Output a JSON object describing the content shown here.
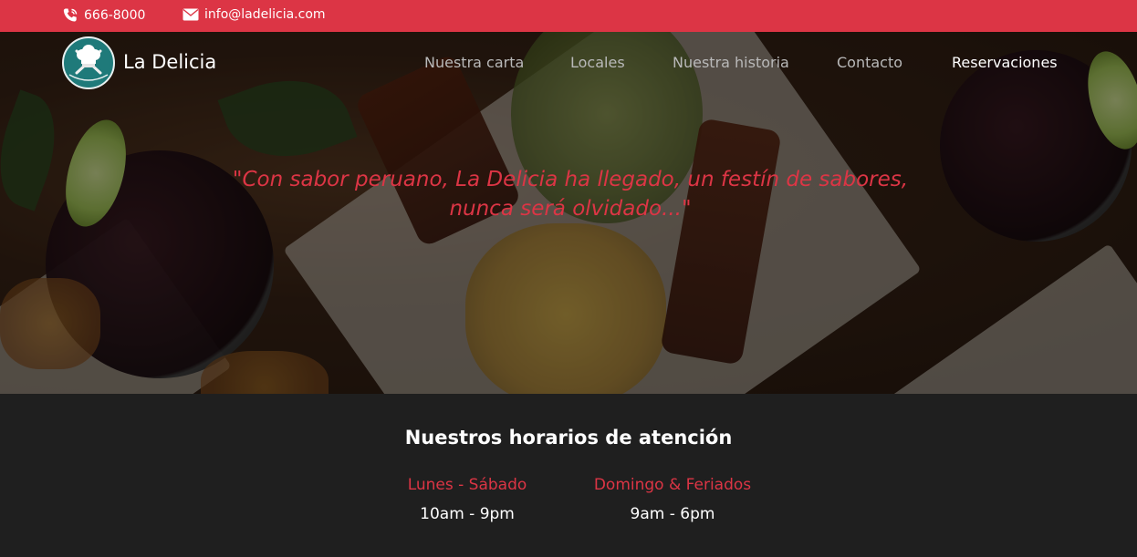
{
  "topbar": {
    "phone": "666-8000",
    "email": "info@ladelicia.com",
    "phone_icon": "phone-icon",
    "email_icon": "envelope-icon"
  },
  "brand": {
    "name": "La Delicia",
    "logo_icon": "chef-hat-logo"
  },
  "nav": {
    "items": [
      {
        "label": "Nuestra carta"
      },
      {
        "label": "Locales"
      },
      {
        "label": "Nuestra historia"
      },
      {
        "label": "Contacto"
      },
      {
        "label": "Reservaciones"
      }
    ],
    "active": "Reservaciones"
  },
  "hero": {
    "quote": "\"Con sabor peruano, La Delicia ha llegado, un festín de sabores, nunca será olvidado...\""
  },
  "hours": {
    "title": "Nuestros horarios de atención",
    "schedule": [
      {
        "days": "Lunes - Sábado",
        "time": "10am - 9pm"
      },
      {
        "days": "Domingo & Feriados",
        "time": "9am - 6pm"
      }
    ]
  },
  "colors": {
    "accent": "#dc3545",
    "dark": "#1f1f1f",
    "nav_text": "#b9b9b9",
    "logo_bg": "#1f7a7a"
  }
}
